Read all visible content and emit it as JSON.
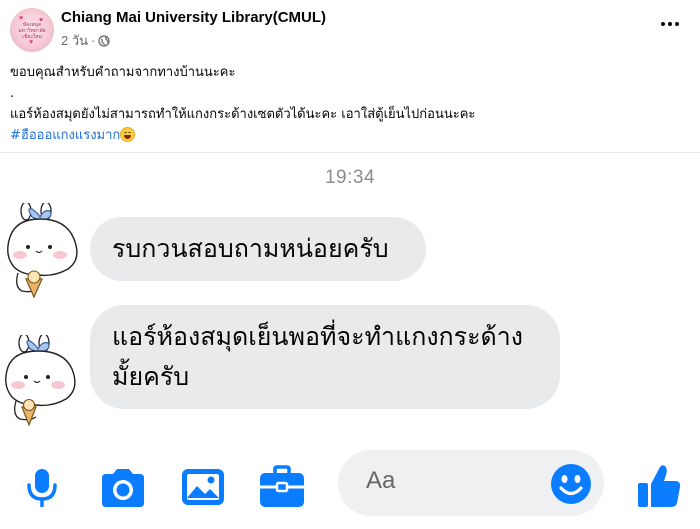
{
  "post": {
    "page_name": "Chiang Mai University Library(CMUL)",
    "time": "2 วัน",
    "separator": "·",
    "avatar_text": "ห้องสมุดมหาวิทยาลัยเชียงใหม่",
    "lines": [
      "ขอบคุณสำหรับคำถามจากทางบ้านนะคะ",
      ".",
      "แอร์ห้องสมุดยังไม่สามารถทำให้แกงกระด้างเซตตัวได้นะคะ เอาใส่ตู้เย็นไปก่อนนะคะ"
    ],
    "hashtag": "#ฮือออแกงแรงมาก"
  },
  "chat": {
    "timestamp": "19:34",
    "messages": [
      {
        "lines": [
          "รบกวนสอบถามหน่อยครับ"
        ]
      },
      {
        "lines": [
          "แอร์ห้องสมุดเย็นพอที่จะทำแกงกระด้าง",
          "มั้ยครับ"
        ]
      }
    ],
    "composer": {
      "placeholder": "Aa",
      "icons": [
        "mic-icon",
        "camera-icon",
        "image-icon",
        "briefcase-icon",
        "smiley-icon",
        "like-icon"
      ]
    }
  },
  "colors": {
    "messenger_blue": "#0a7cff",
    "bubble_gray": "#e9eaeb",
    "hashtag_blue": "#216fdb",
    "meta_gray": "#65676b"
  }
}
